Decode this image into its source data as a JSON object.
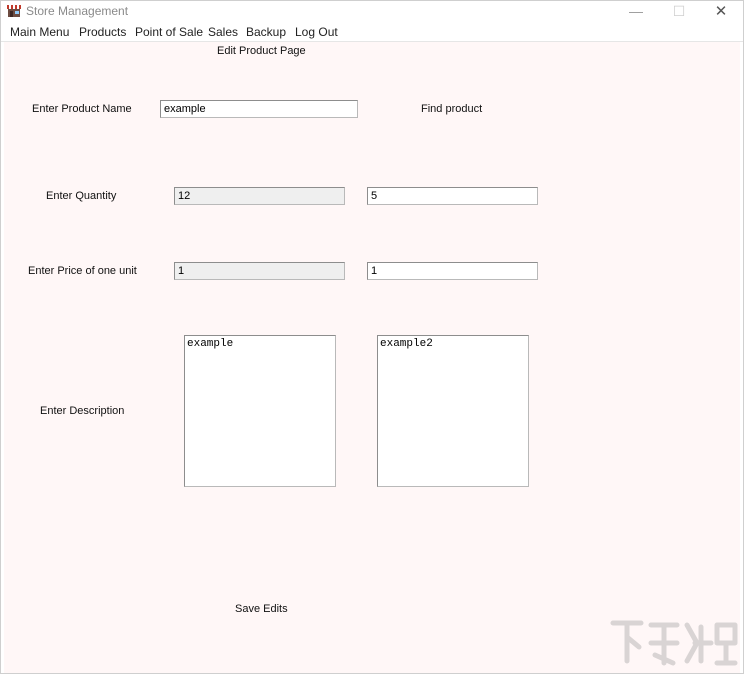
{
  "window": {
    "title": "Store Management",
    "minimize_glyph": "—",
    "maximize_glyph": "☐",
    "close_glyph": "✕"
  },
  "menu": {
    "items": [
      {
        "label": "Main Menu"
      },
      {
        "label": "Products"
      },
      {
        "label": "Point of Sale"
      },
      {
        "label": "Sales"
      },
      {
        "label": "Backup"
      },
      {
        "label": "Log Out"
      }
    ]
  },
  "page": {
    "title": "Edit Product Page",
    "product_name": {
      "label": "Enter Product Name",
      "value": "example",
      "find_button": "Find product"
    },
    "quantity": {
      "label": "Enter Quantity",
      "current_value": "12",
      "new_value": "5"
    },
    "price": {
      "label": "Enter Price of one unit",
      "current_value": "1",
      "new_value": "1"
    },
    "description": {
      "label": "Enter Description",
      "current_value": "example",
      "new_value": "example2"
    },
    "save_button": "Save Edits"
  },
  "colors": {
    "client_background": "#fff7f7",
    "readonly_field": "#efefef"
  },
  "icons": {
    "app": "store-awning-icon"
  }
}
